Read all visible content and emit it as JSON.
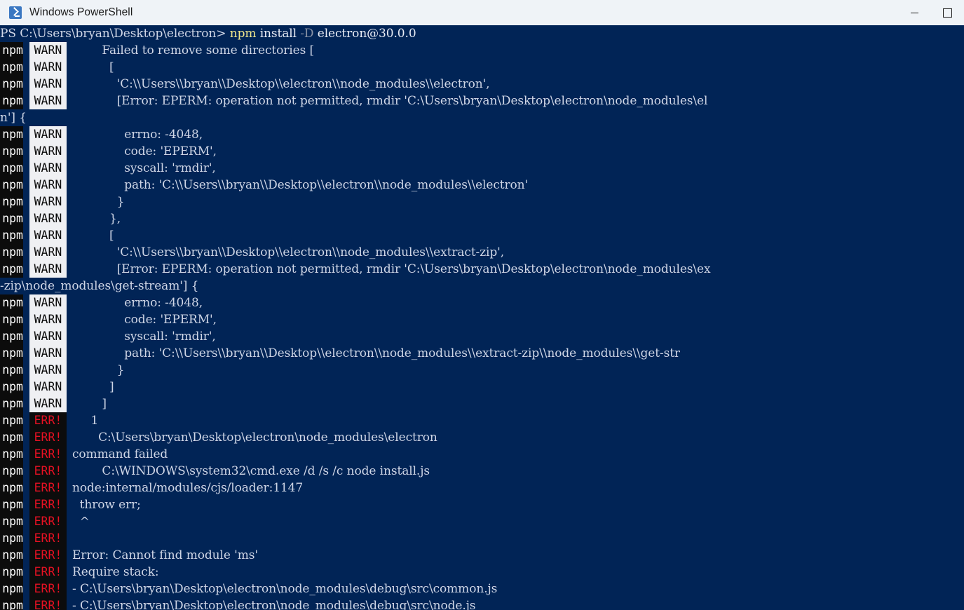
{
  "window": {
    "title": "Windows PowerShell",
    "icon": "powershell-icon",
    "minimize_label": "—",
    "maximize_label": "□",
    "chrome_color": "#eff3f7"
  },
  "terminal": {
    "background_color": "#012456",
    "foreground_color": "#cfd6e6",
    "warn_label": "WARN",
    "warn_bg": "#eff0f3",
    "warn_fg": "#0c0c0c",
    "err_label": "ERR!",
    "err_bg": "#0c0c0c",
    "err_fg": "#e81123",
    "npm_label": "npm",
    "npm_bg": "#0c0c0c",
    "prompt": {
      "path": "PS C:\\Users\\bryan\\Desktop\\electron> ",
      "command_name": "npm",
      "command_args_1": " install ",
      "command_flag": "-D",
      "command_args_2": " electron@30.0.0"
    },
    "lines": [
      {
        "gutter": "warn",
        "text": "        Failed to remove some directories ["
      },
      {
        "gutter": "warn",
        "text": "          ["
      },
      {
        "gutter": "warn",
        "text": "            'C:\\\\Users\\\\bryan\\\\Desktop\\\\electron\\\\node_modules\\\\electron',"
      },
      {
        "gutter": "warn",
        "text": "            [Error: EPERM: operation not permitted, rmdir 'C:\\Users\\bryan\\Desktop\\electron\\node_modules\\el"
      },
      {
        "gutter": "none",
        "text": "n'] {"
      },
      {
        "gutter": "warn",
        "text": "              errno: -4048,"
      },
      {
        "gutter": "warn",
        "text": "              code: 'EPERM',"
      },
      {
        "gutter": "warn",
        "text": "              syscall: 'rmdir',"
      },
      {
        "gutter": "warn",
        "text": "              path: 'C:\\\\Users\\\\bryan\\\\Desktop\\\\electron\\\\node_modules\\\\electron'"
      },
      {
        "gutter": "warn",
        "text": "            }"
      },
      {
        "gutter": "warn",
        "text": "          },"
      },
      {
        "gutter": "warn",
        "text": "          ["
      },
      {
        "gutter": "warn",
        "text": "            'C:\\\\Users\\\\bryan\\\\Desktop\\\\electron\\\\node_modules\\\\extract-zip',"
      },
      {
        "gutter": "warn",
        "text": "            [Error: EPERM: operation not permitted, rmdir 'C:\\Users\\bryan\\Desktop\\electron\\node_modules\\ex"
      },
      {
        "gutter": "none",
        "text": "-zip\\node_modules\\get-stream'] {"
      },
      {
        "gutter": "warn",
        "text": "              errno: -4048,"
      },
      {
        "gutter": "warn",
        "text": "              code: 'EPERM',"
      },
      {
        "gutter": "warn",
        "text": "              syscall: 'rmdir',"
      },
      {
        "gutter": "warn",
        "text": "              path: 'C:\\\\Users\\\\bryan\\\\Desktop\\\\electron\\\\node_modules\\\\extract-zip\\\\node_modules\\\\get-str"
      },
      {
        "gutter": "warn",
        "text": "            }"
      },
      {
        "gutter": "warn",
        "text": "          ]"
      },
      {
        "gutter": "warn",
        "text": "        ]"
      },
      {
        "gutter": "err",
        "text": "     1"
      },
      {
        "gutter": "err",
        "text": "       C:\\Users\\bryan\\Desktop\\electron\\node_modules\\electron"
      },
      {
        "gutter": "err",
        "text": "command failed"
      },
      {
        "gutter": "err",
        "text": "        C:\\WINDOWS\\system32\\cmd.exe /d /s /c node install.js"
      },
      {
        "gutter": "err",
        "text": "node:internal/modules/cjs/loader:1147"
      },
      {
        "gutter": "err",
        "text": "  throw err;"
      },
      {
        "gutter": "err",
        "text": "  ^"
      },
      {
        "gutter": "err",
        "text": ""
      },
      {
        "gutter": "err",
        "text": "Error: Cannot find module 'ms'"
      },
      {
        "gutter": "err",
        "text": "Require stack:"
      },
      {
        "gutter": "err",
        "text": "- C:\\Users\\bryan\\Desktop\\electron\\node_modules\\debug\\src\\common.js"
      },
      {
        "gutter": "err",
        "text": "- C:\\Users\\bryan\\Desktop\\electron\\node_modules\\debug\\src\\node.js"
      }
    ]
  }
}
